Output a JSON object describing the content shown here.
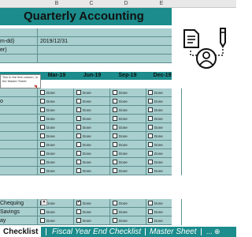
{
  "columns": [
    "B",
    "C",
    "D",
    "E"
  ],
  "title": "Quarterly Accounting Checklist",
  "info_rows": [
    {
      "label": "",
      "value": ""
    },
    {
      "label": "m-dd)",
      "value": "2019/12/31"
    },
    {
      "label": "er)",
      "value": ""
    },
    {
      "label": "",
      "value": ""
    }
  ],
  "tooltip": "Tick in the first column, in the Master Sheet.",
  "months": [
    "Mar-19",
    "Jun-19",
    "Sep-19",
    "Dec-19"
  ],
  "done_label": "Done",
  "rows_top": [
    {
      "label": "",
      "checks": [
        false,
        false,
        false,
        false
      ]
    },
    {
      "label": "o",
      "checks": [
        false,
        false,
        false,
        false
      ]
    },
    {
      "label": "",
      "checks": [
        false,
        false,
        false,
        false
      ]
    },
    {
      "label": "",
      "checks": [
        false,
        false,
        false,
        false
      ]
    },
    {
      "label": "",
      "checks": [
        false,
        false,
        false,
        false
      ]
    },
    {
      "label": "",
      "checks": [
        false,
        false,
        false,
        false
      ]
    },
    {
      "label": "",
      "checks": [
        false,
        false,
        false,
        false
      ]
    },
    {
      "label": "",
      "checks": [
        false,
        false,
        false,
        false
      ]
    },
    {
      "label": "",
      "checks": [
        false,
        false,
        false,
        false
      ]
    },
    {
      "label": "",
      "checks": [
        false,
        false,
        false,
        false
      ]
    }
  ],
  "rows_bottom": [
    {
      "label": "Chequing",
      "checks": [
        false,
        true,
        false,
        false
      ]
    },
    {
      "label": "Savings",
      "checks": [
        false,
        false,
        false,
        false
      ]
    },
    {
      "label": "ay",
      "checks": [
        false,
        false,
        false,
        false
      ]
    }
  ],
  "tabs": {
    "active": "Checklist",
    "second": "Fiscal Year End Checklist",
    "third": "Master Sheet",
    "more": "... ⊕"
  },
  "colors": {
    "accent": "#1c8c8c",
    "row": "#a9cfcf"
  }
}
